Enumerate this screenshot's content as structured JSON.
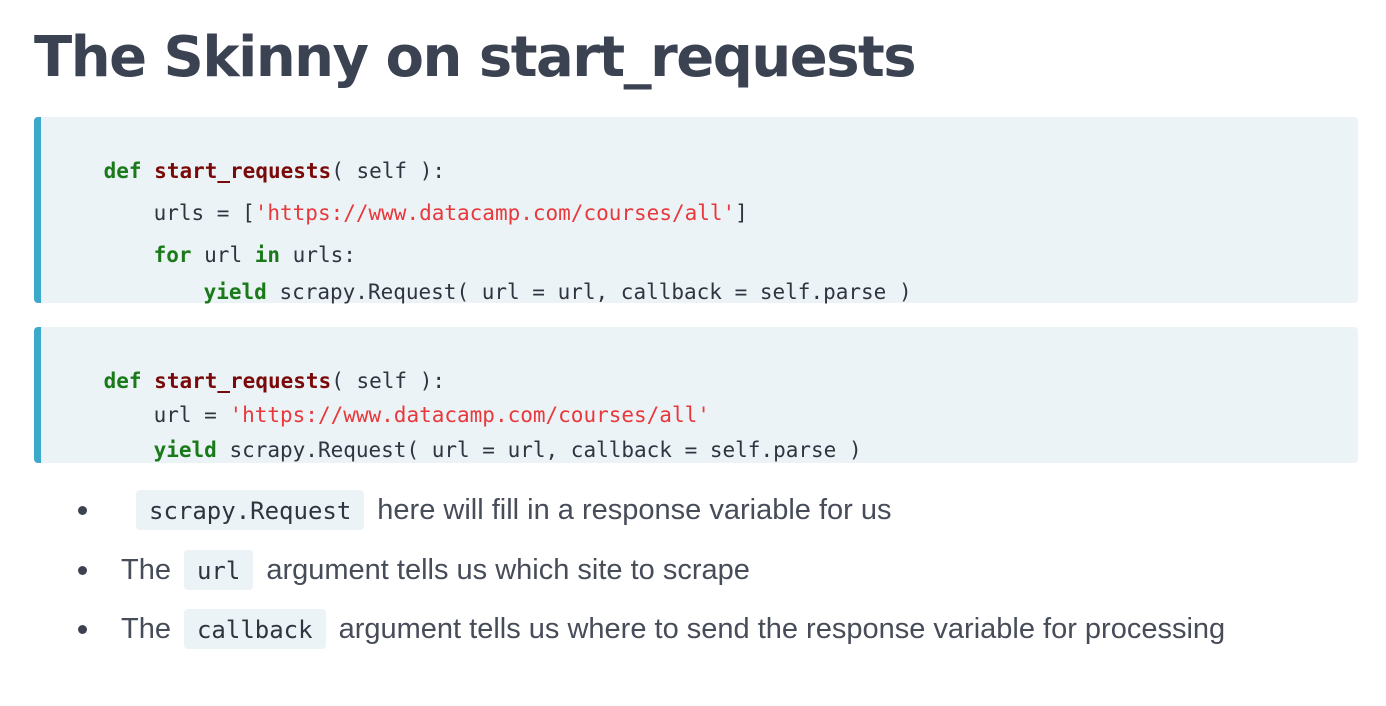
{
  "title": "The Skinny on start_requests",
  "code_block_1": {
    "l1_kw": "def",
    "l1_fn": "start_requests",
    "l1_rest": "( self ):",
    "l2_pre": "urls = [",
    "l2_str": "'https://www.datacamp.com/courses/all'",
    "l2_post": "]",
    "l3_kw1": "for",
    "l3_mid": " url ",
    "l3_kw2": "in",
    "l3_rest": " urls:",
    "l4_kw": "yield",
    "l4_rest": " scrapy.Request( url = url, callback = self.parse )"
  },
  "code_block_2": {
    "l1_kw": "def",
    "l1_fn": "start_requests",
    "l1_rest": "( self ):",
    "l2_pre": "url = ",
    "l2_str": "'https://www.datacamp.com/courses/all'",
    "l3_kw": "yield",
    "l3_rest": " scrapy.Request( url = url, callback = self.parse )"
  },
  "bullets": [
    {
      "pre": "",
      "code": "scrapy.Request",
      "post": "here will fill in a response variable for us"
    },
    {
      "pre": "The",
      "code": "url",
      "post": "argument tells us which site to scrape"
    },
    {
      "pre": "The",
      "code": "callback",
      "post": "argument tells us where to send the response variable for processing"
    }
  ],
  "colors": {
    "accent_border": "#3ba9c9",
    "code_background": "#ebf3f6",
    "keyword": "#1a7a1a",
    "function_name": "#7a0a0a",
    "string": "#e8383b"
  }
}
